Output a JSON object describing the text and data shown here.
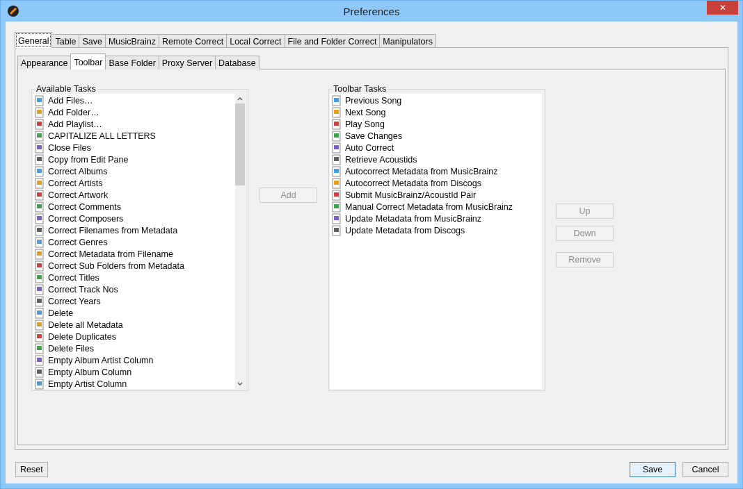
{
  "window": {
    "title": "Preferences",
    "close": "✕"
  },
  "tabs": [
    {
      "label": "General",
      "selected": true
    },
    {
      "label": "Table",
      "selected": false
    },
    {
      "label": "Save",
      "selected": false
    },
    {
      "label": "MusicBrainz",
      "selected": false
    },
    {
      "label": "Remote Correct",
      "selected": false
    },
    {
      "label": "Local Correct",
      "selected": false
    },
    {
      "label": "File and Folder Correct",
      "selected": false
    },
    {
      "label": "Manipulators",
      "selected": false
    }
  ],
  "subtabs": [
    {
      "label": "Appearance",
      "selected": false
    },
    {
      "label": "Toolbar",
      "selected": true
    },
    {
      "label": "Base Folder",
      "selected": false
    },
    {
      "label": "Proxy Server",
      "selected": false
    },
    {
      "label": "Database",
      "selected": false
    }
  ],
  "available_tasks": {
    "title": "Available Tasks",
    "items": [
      "Add Files…",
      "Add Folder…",
      "Add Playlist…",
      "CAPITALIZE ALL LETTERS",
      "Close Files",
      "Copy from Edit Pane",
      "Correct Albums",
      "Correct Artists",
      "Correct Artwork",
      "Correct Comments",
      "Correct Composers",
      "Correct Filenames from Metadata",
      "Correct Genres",
      "Correct Metadata from Filename",
      "Correct Sub Folders from Metadata",
      "Correct Titles",
      "Correct Track Nos",
      "Correct Years",
      "Delete",
      "Delete all Metadata",
      "Delete Duplicates",
      "Delete Files",
      "Empty Album Artist Column",
      "Empty Album Column",
      "Empty Artist Column"
    ]
  },
  "add_button": {
    "label": "Add",
    "disabled": true
  },
  "toolbar_tasks": {
    "title": "Toolbar Tasks",
    "items": [
      "Previous Song",
      "Next Song",
      "Play Song",
      "Save Changes",
      "Auto Correct",
      "Retrieve Acoustids",
      "Autocorrect Metadata from MusicBrainz",
      "Autocorrect Metadata from Discogs",
      "Submit MusicBrainz/AcoustId Pair",
      "Manual Correct Metadata from MusicBrainz",
      "Update Metadata from MusicBrainz",
      "Update Metadata from Discogs"
    ]
  },
  "side_buttons": [
    {
      "label": "Up",
      "disabled": true
    },
    {
      "label": "Down",
      "disabled": true
    },
    {
      "label": "Remove",
      "disabled": true
    }
  ],
  "footer": {
    "reset": "Reset",
    "save": "Save",
    "cancel": "Cancel"
  }
}
